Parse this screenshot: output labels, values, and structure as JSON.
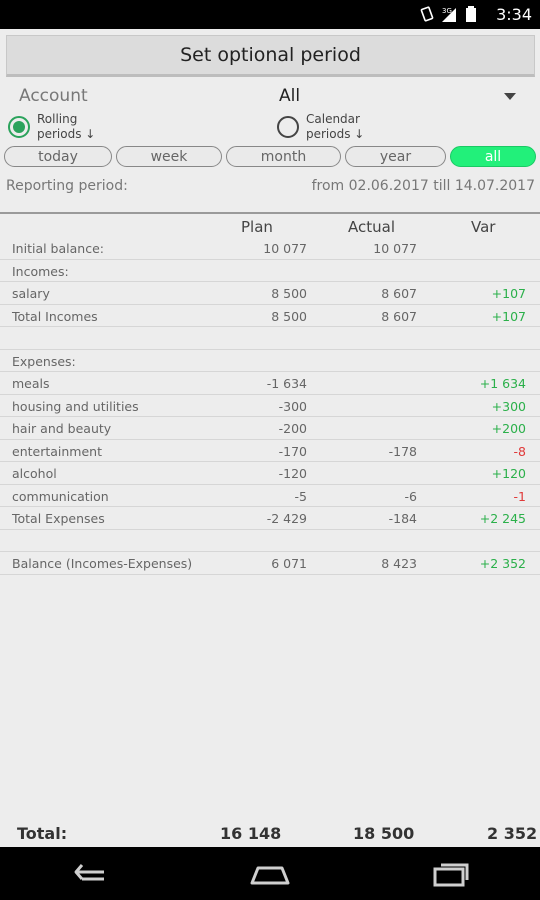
{
  "status_bar": {
    "time": "3:34",
    "icons": [
      "rotate-icon",
      "signal-3g-icon",
      "battery-icon"
    ]
  },
  "period_button": {
    "label": "Set optional period"
  },
  "account": {
    "label": "Account",
    "value": "All"
  },
  "radios": [
    {
      "label": "Rolling periods ↓",
      "selected": true
    },
    {
      "label": "Calendar periods ↓",
      "selected": false
    }
  ],
  "pills": [
    {
      "label": "today",
      "active": false
    },
    {
      "label": "week",
      "active": false
    },
    {
      "label": "month",
      "active": false
    },
    {
      "label": "year",
      "active": false
    },
    {
      "label": "all",
      "active": true
    }
  ],
  "reporting": {
    "label": "Reporting period:",
    "value": "from 02.06.2017 till 14.07.2017"
  },
  "table": {
    "headers": {
      "plan": "Plan",
      "actual": "Actual",
      "var": "Var"
    },
    "rows": [
      {
        "name": "Initial balance:",
        "plan": "10 077",
        "actual": "10 077",
        "var": "",
        "var_sign": ""
      },
      {
        "name": "Incomes:",
        "plan": "",
        "actual": "",
        "var": "",
        "var_sign": ""
      },
      {
        "name": "salary",
        "plan": "8 500",
        "actual": "8 607",
        "var": "+107",
        "var_sign": "pos"
      },
      {
        "name": "Total Incomes",
        "plan": "8 500",
        "actual": "8 607",
        "var": "+107",
        "var_sign": "pos"
      },
      {
        "name": "",
        "plan": "",
        "actual": "",
        "var": "",
        "var_sign": ""
      },
      {
        "name": "Expenses:",
        "plan": "",
        "actual": "",
        "var": "",
        "var_sign": ""
      },
      {
        "name": "meals",
        "plan": "-1 634",
        "actual": "",
        "var": "+1 634",
        "var_sign": "pos"
      },
      {
        "name": "housing and utilities",
        "plan": "-300",
        "actual": "",
        "var": "+300",
        "var_sign": "pos"
      },
      {
        "name": "hair and beauty",
        "plan": "-200",
        "actual": "",
        "var": "+200",
        "var_sign": "pos"
      },
      {
        "name": "entertainment",
        "plan": "-170",
        "actual": "-178",
        "var": "-8",
        "var_sign": "neg"
      },
      {
        "name": "alcohol",
        "plan": "-120",
        "actual": "",
        "var": "+120",
        "var_sign": "pos"
      },
      {
        "name": "communication",
        "plan": "-5",
        "actual": "-6",
        "var": "-1",
        "var_sign": "neg"
      },
      {
        "name": "Total Expenses",
        "plan": "-2 429",
        "actual": "-184",
        "var": "+2 245",
        "var_sign": "pos"
      },
      {
        "name": "",
        "plan": "",
        "actual": "",
        "var": "",
        "var_sign": ""
      },
      {
        "name": "Balance (Incomes-Expenses)",
        "plan": "6 071",
        "actual": "8 423",
        "var": "+2 352",
        "var_sign": "pos"
      }
    ]
  },
  "totals": {
    "label": "Total:",
    "plan": "16 148",
    "actual": "18 500",
    "var": "2 352"
  },
  "nav": {
    "back": "back-icon",
    "home": "home-icon",
    "recents": "recents-icon"
  }
}
